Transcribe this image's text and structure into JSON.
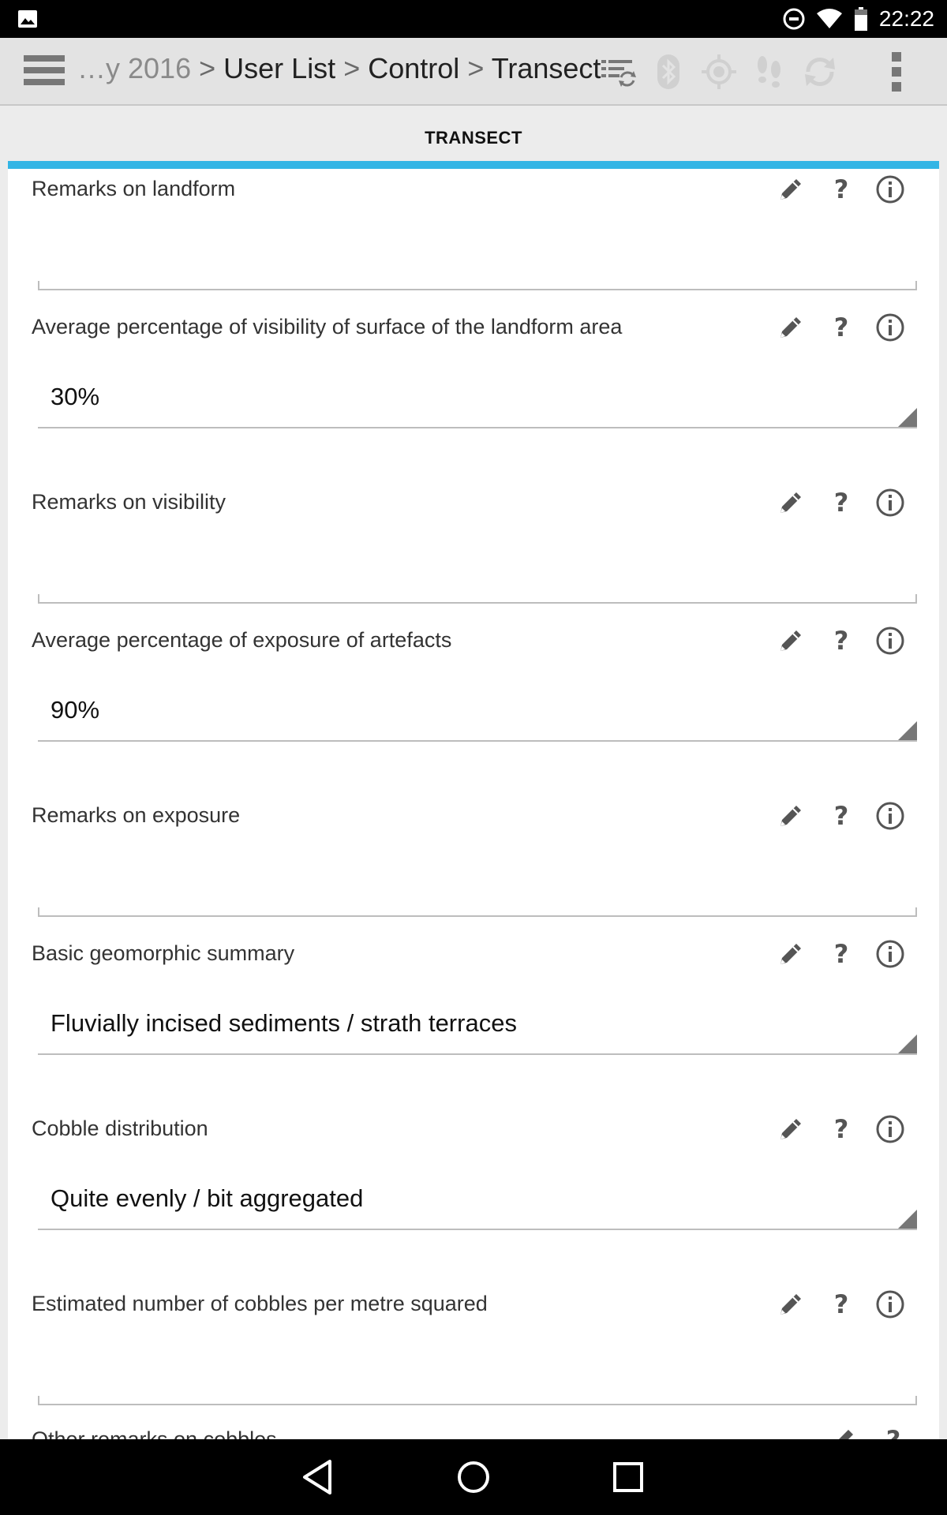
{
  "status_bar": {
    "time": "22:22",
    "icons": [
      "image-notification-icon",
      "do-not-disturb-icon",
      "wifi-icon",
      "battery-icon"
    ]
  },
  "action_bar": {
    "breadcrumb": {
      "muted": "…y 2016",
      "items": [
        "User List",
        "Control",
        "Transect"
      ],
      "separator": ">"
    },
    "icons": [
      "menu-icon",
      "sync-list-icon",
      "bluetooth-icon",
      "gps-icon",
      "footsteps-icon",
      "refresh-icon",
      "overflow-menu-icon"
    ]
  },
  "tab": {
    "title": "TRANSECT"
  },
  "fields": [
    {
      "label": "Remarks on landform",
      "value": "",
      "dropdown": false
    },
    {
      "label": "Average percentage of visibility of surface of the landform area",
      "value": "30%",
      "dropdown": true
    },
    {
      "label": "Remarks on visibility",
      "value": "",
      "dropdown": false
    },
    {
      "label": "Average percentage of exposure of artefacts",
      "value": "90%",
      "dropdown": true
    },
    {
      "label": "Remarks on exposure",
      "value": "",
      "dropdown": false
    },
    {
      "label": "Basic geomorphic summary",
      "value": "Fluvially incised sediments / strath terraces",
      "dropdown": true
    },
    {
      "label": "Cobble distribution",
      "value": "Quite evenly / bit aggregated",
      "dropdown": true
    },
    {
      "label": "Estimated number of cobbles per metre squared",
      "value": "",
      "dropdown": false
    },
    {
      "label": "Other remarks on cobbles",
      "value": "",
      "dropdown": false
    }
  ],
  "field_icons": {
    "edit": "pencil-icon",
    "help": "?",
    "info": "info-icon"
  },
  "colors": {
    "accent": "#33b5e5",
    "action_bar": "#e3e3e3",
    "icon_gray": "#777777"
  },
  "nav_bar": [
    "back-icon",
    "home-icon",
    "recents-icon"
  ]
}
